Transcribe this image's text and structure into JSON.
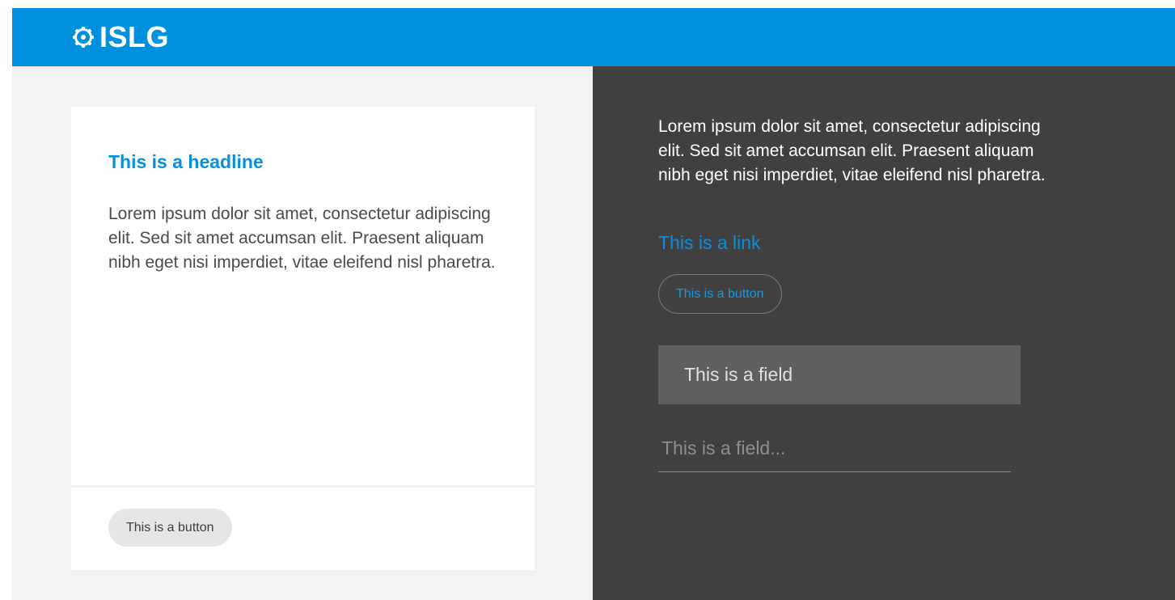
{
  "header": {
    "logo_icon": "gear-icon",
    "brand": "ISLG",
    "background_color": "#0090de"
  },
  "light_panel": {
    "background_color": "#f1f2f4",
    "card": {
      "headline": "This is a headline",
      "body": "Lorem ipsum dolor sit amet, consectetur adipiscing elit. Sed sit amet accumsan elit. Praesent aliquam nibh eget nisi imperdiet, vitae eleifend nisl pharetra.",
      "button_label": "This is a button"
    }
  },
  "dark_panel": {
    "background_color": "#404040",
    "body": "Lorem ipsum dolor sit amet, consectetur adipiscing elit. Sed sit amet accumsan elit. Praesent aliquam nibh eget nisi imperdiet, vitae eleifend nisl pharetra.",
    "link_label": "This is a link",
    "button_label": "This is a button",
    "field_filled": {
      "placeholder": "This is a field"
    },
    "field_underline": {
      "placeholder": "This is a field..."
    }
  },
  "accent_color": "#0a8fdc"
}
